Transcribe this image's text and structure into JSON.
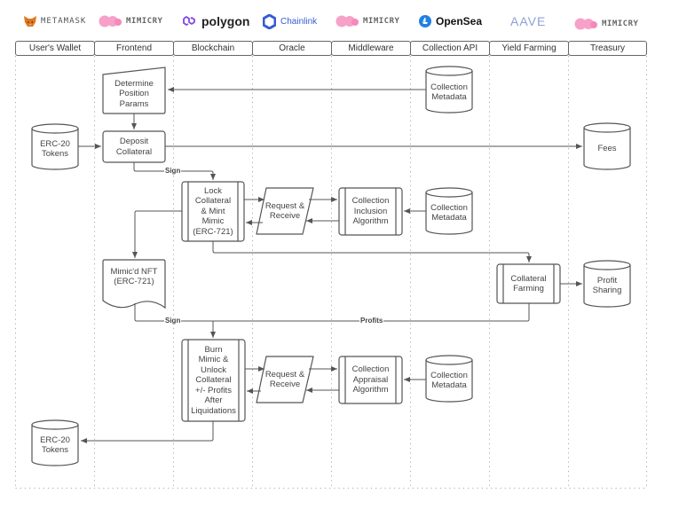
{
  "logos": [
    {
      "name": "metamask",
      "text": "METAMASK",
      "icon": "fox-icon"
    },
    {
      "name": "mimicry-1",
      "text": "MIMICRY",
      "icon": "mimicry-blob-icon"
    },
    {
      "name": "polygon",
      "text": "polygon",
      "icon": "polygon-link-icon"
    },
    {
      "name": "chainlink",
      "text": "Chainlink",
      "icon": "chainlink-hexagon-icon"
    },
    {
      "name": "mimicry-2",
      "text": "MIMICRY",
      "icon": "mimicry-blob-icon"
    },
    {
      "name": "opensea",
      "text": "OpenSea",
      "icon": "opensea-boat-icon"
    },
    {
      "name": "aave",
      "text": "AAVE",
      "icon": "aave-icon"
    },
    {
      "name": "mimicry-3",
      "text": "MIMICRY",
      "icon": "mimicry-blob-icon"
    }
  ],
  "colors": {
    "line": "#555555",
    "lane_divider": "#b0b0b0",
    "metamask_orange": "#e2761b",
    "mimicry_pink": "#f59ac4",
    "polygon_purple": "#8247e5",
    "chainlink_blue": "#375bd2",
    "opensea_blue": "#2081e2",
    "aave_purple": "#8f9fd6"
  },
  "lanes": [
    "User's Wallet",
    "Frontend",
    "Blockchain",
    "Oracle",
    "Middleware",
    "Collection API",
    "Yield Farming",
    "Treasury"
  ],
  "nodes": {
    "determine_params": "Determine\nPosition\nParams",
    "collection_metadata_1": "Collection\nMetadata",
    "erc20_tokens_in": "ERC-20\nTokens",
    "deposit_collateral": "Deposit\nCollateral",
    "fees": "Fees",
    "lock_mint": "Lock\nCollateral\n& Mint\nMimic\n(ERC-721)",
    "request_receive_1": "Request &\nReceive",
    "inclusion_algorithm": "Collection\nInclusion\nAlgorithm",
    "collection_metadata_2": "Collection\nMetadata",
    "mimicd_nft": "Mimic'd NFT\n(ERC-721)",
    "collateral_farming": "Collateral\nFarming",
    "profit_sharing": "Profit\nSharing",
    "burn_unlock": "Burn\nMimic &\nUnlock\nCollateral\n+/- Profits\nAfter\nLiquidations",
    "request_receive_2": "Request &\nReceive",
    "appraisal_algorithm": "Collection\nAppraisal\nAlgorithm",
    "collection_metadata_3": "Collection\nMetadata",
    "erc20_tokens_out": "ERC-20\nTokens"
  },
  "edge_labels": {
    "sign_1": "Sign",
    "sign_2": "Sign",
    "profits": "Profits"
  }
}
